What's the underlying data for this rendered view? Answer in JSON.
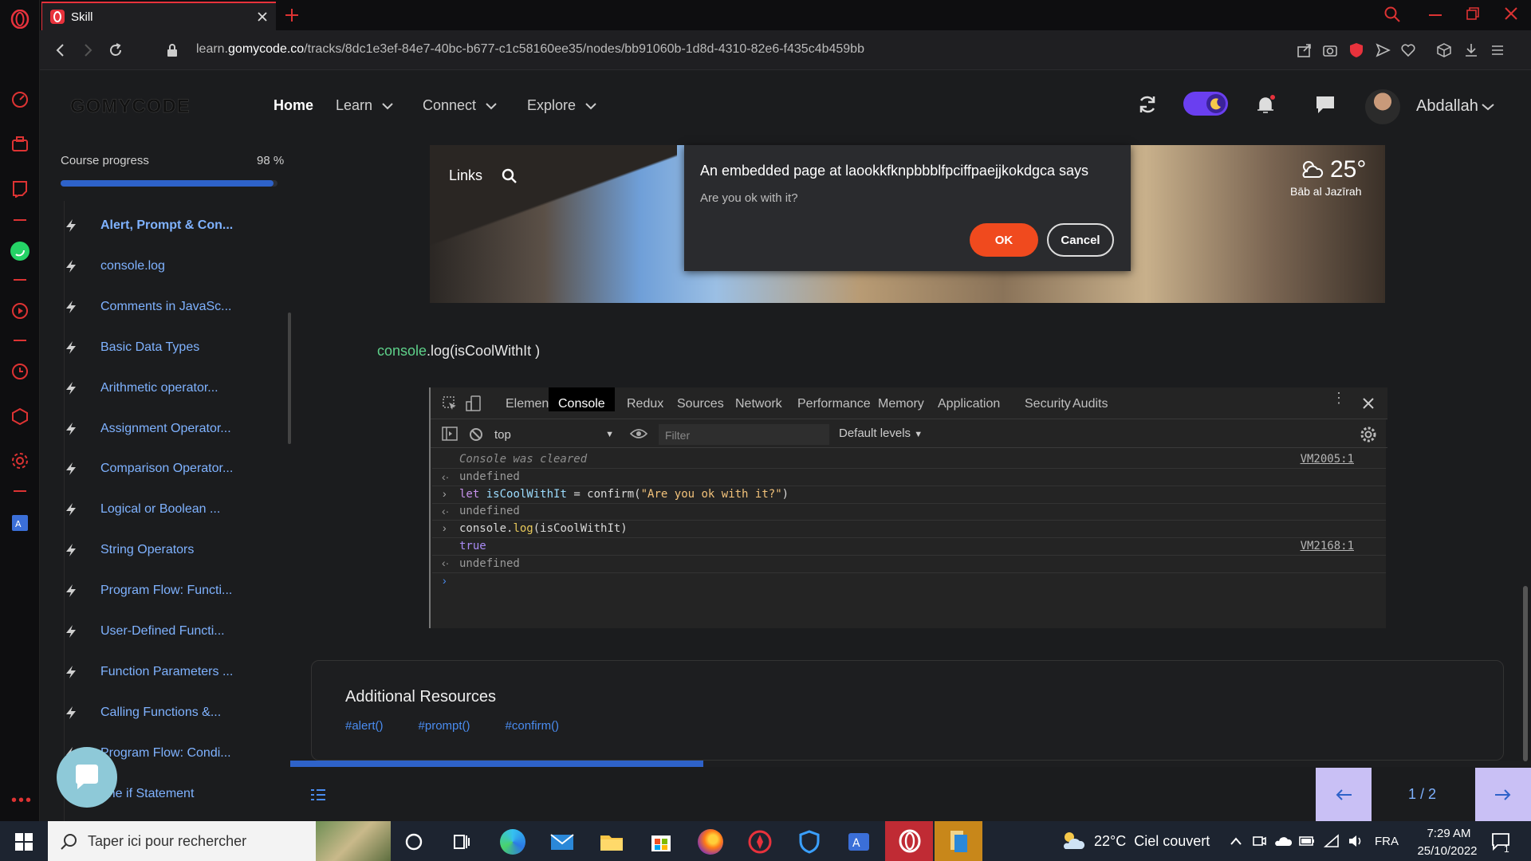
{
  "browser": {
    "tab_title": "Skill",
    "url_prefix": "learn.",
    "url_domain": "gomycode.co",
    "url_path": "/tracks/8dc1e3ef-84e7-40bc-b677-c1c58160ee35/nodes/bb91060b-1d8d-4310-82e6-f435c4b459bb",
    "accent": "#e8323c"
  },
  "header": {
    "logo": "GOMYCODE",
    "nav": {
      "home": "Home",
      "learn": "Learn",
      "connect": "Connect",
      "explore": "Explore"
    },
    "user_name": "Abdallah"
  },
  "sidebar": {
    "progress_label": "Course progress",
    "progress_text": "98 %",
    "progress_value": 0.98,
    "lessons": [
      "Alert, Prompt & Con...",
      "console.log",
      "Comments in JavaSc...",
      "Basic Data Types",
      "Arithmetic operator...",
      "Assignment Operator...",
      "Comparison Operator...",
      "Logical or Boolean ...",
      "String Operators",
      "Program Flow: Functi...",
      "User-Defined Functi...",
      "Function Parameters ...",
      "Calling Functions &...",
      "Program Flow: Condi...",
      "The if Statement"
    ]
  },
  "newtab": {
    "links_label": "Links",
    "weather_temp": "25°",
    "weather_place": "Bāb al Jazīrah"
  },
  "dialog": {
    "title": "An embedded page at laookkfknpbbblfpciffpaejjkokdgca says",
    "message": "Are you ok with it?",
    "ok": "OK",
    "cancel": "Cancel"
  },
  "code_caption": {
    "obj": "console",
    "rest": ".log(isCoolWithIt )"
  },
  "devtools": {
    "tabs": [
      "Elements",
      "Console",
      "Redux",
      "Sources",
      "Network",
      "Performance",
      "Memory",
      "Application",
      "Security",
      "Audits"
    ],
    "active_tab": "Console",
    "context": "top",
    "filter_placeholder": "Filter",
    "levels": "Default levels",
    "lines": {
      "cleared": "Console was cleared",
      "ref1": "VM2005:1",
      "undef": "undefined",
      "let_kw": "let",
      "let_var": "isCoolWithIt",
      "let_eq": "= confirm(",
      "let_str": "\"Are you ok with it?\"",
      "let_close": ")",
      "log_pre": "console.",
      "log_fn": "log",
      "log_arg": "(isCoolWithIt)",
      "result": "true",
      "ref2": "VM2168:1"
    }
  },
  "resources": {
    "title": "Additional Resources",
    "tags": [
      "#alert()",
      "#prompt()",
      "#confirm()"
    ]
  },
  "pager": {
    "text": "1 / 2"
  },
  "taskbar": {
    "search_placeholder": "Taper ici pour rechercher",
    "weather": "22°C  Ciel couvert",
    "lang": "FRA",
    "time": "7:29 AM",
    "date": "25/10/2022",
    "notif_count": "1"
  }
}
